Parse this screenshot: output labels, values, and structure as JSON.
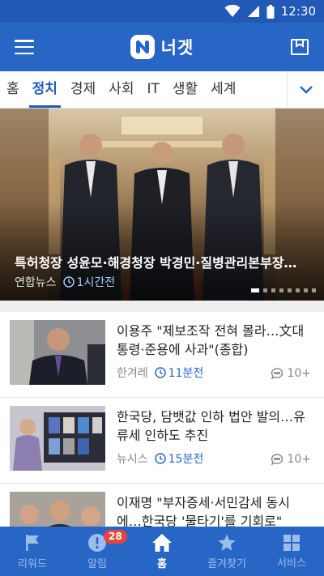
{
  "status_bar": {
    "time": "12:30"
  },
  "app_bar": {
    "brand_name": "너겟"
  },
  "tabs": [
    "홈",
    "정치",
    "경제",
    "사회",
    "IT",
    "생활",
    "세계"
  ],
  "active_tab": "정치",
  "hero": {
    "title": "특허청장 성윤모·해경청장 박경민·질병관리본부장…",
    "source": "연합뉴스",
    "time": "1시간전",
    "slide_count": 8,
    "active_slide": 0
  },
  "news": [
    {
      "title": "이용주 \"제보조작 전혀 몰라…文대통령·준용에 사과\"(종합)",
      "source": "한겨레",
      "time": "11분전",
      "comments": "10+"
    },
    {
      "title": "한국당, 담뱃값 인하 법안 발의…유류세 인하도 추진",
      "source": "뉴시스",
      "time": "15분전",
      "comments": "10+"
    },
    {
      "title": "이재명 \"부자증세·서민감세 동시에…한국당 '물타기'를 기회로\"",
      "source": "",
      "time": "",
      "comments": ""
    }
  ],
  "bottom_nav": [
    {
      "label": "리워드",
      "icon": "flag-icon"
    },
    {
      "label": "알림",
      "icon": "alert-icon",
      "badge": "28"
    },
    {
      "label": "홈",
      "icon": "home-icon"
    },
    {
      "label": "즐겨찾기",
      "icon": "star-icon"
    },
    {
      "label": "서비스",
      "icon": "grid-icon"
    }
  ],
  "active_nav": "홈",
  "colors": {
    "primary": "#2866c6",
    "status_bar": "#2258b6",
    "accent_text": "#1f5bbf",
    "badge": "#e8453c"
  }
}
